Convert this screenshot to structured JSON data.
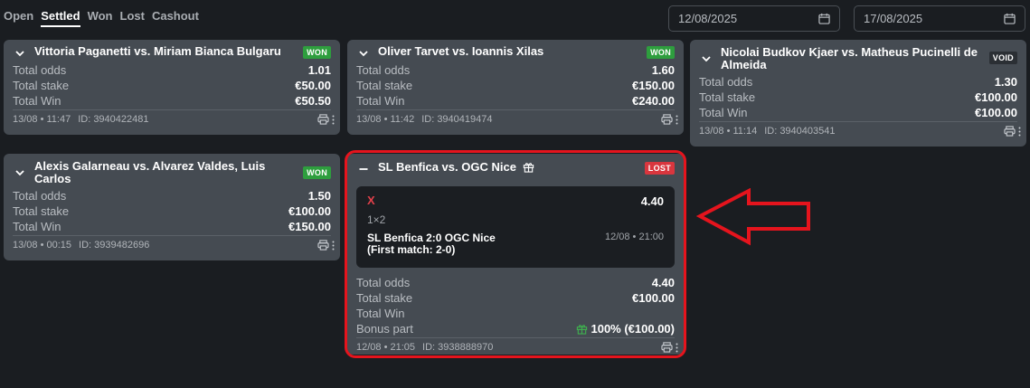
{
  "tabs": [
    "Open",
    "Settled",
    "Won",
    "Lost",
    "Cashout"
  ],
  "active_tab": "Settled",
  "date_from": "12/08/2025",
  "date_to": "17/08/2025",
  "labels": {
    "total_odds": "Total odds",
    "total_stake": "Total stake",
    "total_win": "Total Win",
    "bonus_part": "Bonus part"
  },
  "cards": [
    {
      "title": "Vittoria Paganetti vs. Miriam Bianca Bulgaru",
      "status": "WON",
      "total_odds": "1.01",
      "total_stake": "€50.00",
      "total_win": "€50.50",
      "datetime": "13/08 • 11:47",
      "id": "ID: 3940422481"
    },
    {
      "title": "Oliver Tarvet vs. Ioannis Xilas",
      "status": "WON",
      "total_odds": "1.60",
      "total_stake": "€150.00",
      "total_win": "€240.00",
      "datetime": "13/08 • 11:42",
      "id": "ID: 3940419474"
    },
    {
      "title": "Nicolai Budkov Kjaer vs. Matheus Pucinelli de Almeida",
      "status": "VOID",
      "total_odds": "1.30",
      "total_stake": "€100.00",
      "total_win": "€100.00",
      "datetime": "13/08 • 11:14",
      "id": "ID: 3940403541"
    },
    {
      "title": "Alexis Galarneau vs. Alvarez Valdes, Luis Carlos",
      "status": "WON",
      "total_odds": "1.50",
      "total_stake": "€100.00",
      "total_win": "€150.00",
      "datetime": "13/08 • 00:15",
      "id": "ID: 3939482696"
    }
  ],
  "expanded_card": {
    "title": "SL Benfica vs. OGC Nice",
    "status": "LOST",
    "selection": {
      "pick": "X",
      "odds": "4.40",
      "market": "1×2",
      "event_line1": "SL Benfica 2:0 OGC Nice",
      "event_line2": "(First match: 2-0)",
      "event_time": "12/08 • 21:00"
    },
    "total_odds": "4.40",
    "total_stake": "€100.00",
    "total_win": "",
    "bonus_part": "100% (€100.00)",
    "datetime": "12/08 • 21:05",
    "id": "ID: 3938888970"
  },
  "colors": {
    "background": "#1a1d21",
    "card": "#454b52",
    "won": "#2e9e3e",
    "lost": "#d9363e",
    "void": "#2b2f34",
    "highlight": "#e5141d"
  }
}
